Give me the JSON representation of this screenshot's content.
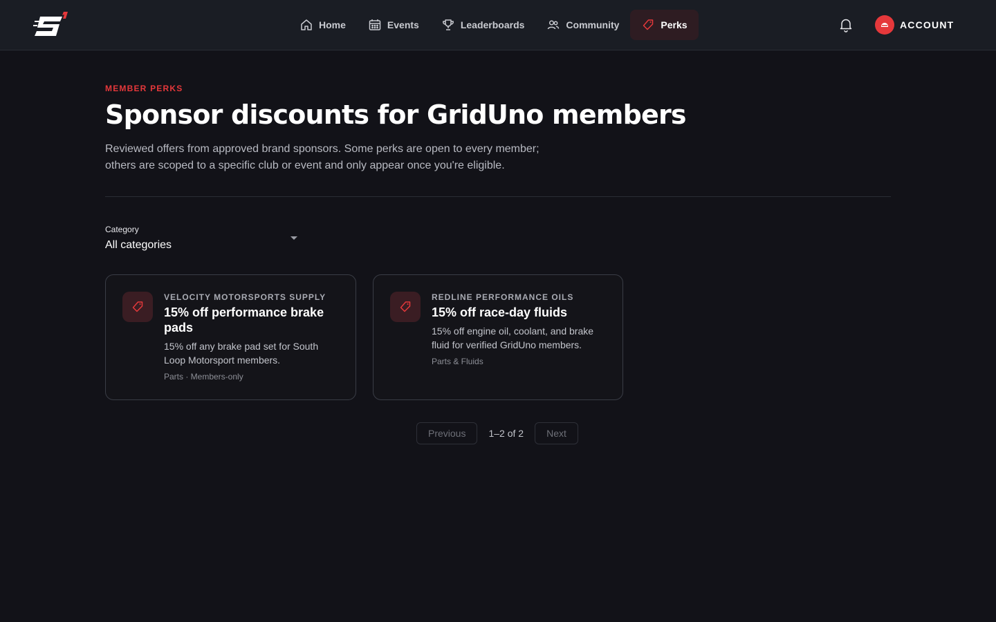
{
  "colors": {
    "accent": "#e5383b",
    "background": "#121218",
    "topbar": "#1a1d24",
    "active_nav_bg": "#2e1c22"
  },
  "header": {
    "logo_icon": "gridUno-logo",
    "nav": [
      {
        "label": "Home",
        "icon": "home-icon",
        "active": false
      },
      {
        "label": "Events",
        "icon": "calendar-icon",
        "active": false
      },
      {
        "label": "Leaderboards",
        "icon": "trophy-icon",
        "active": false
      },
      {
        "label": "Community",
        "icon": "users-icon",
        "active": false
      },
      {
        "label": "Perks",
        "icon": "tag-icon",
        "active": true
      }
    ],
    "notifications_icon": "bell-icon",
    "account_label": "ACCOUNT"
  },
  "main": {
    "eyebrow": "MEMBER PERKS",
    "title": "Sponsor discounts for GridUno members",
    "description_line1": "Reviewed offers from approved brand sponsors. Some perks are open to every member;",
    "description_line2": "others are scoped to a specific club or event and only appear once you're eligible.",
    "filter": {
      "label": "Category",
      "value": "All categories"
    },
    "perks": [
      {
        "sponsor": "VELOCITY MOTORSPORTS SUPPLY",
        "title": "15% off performance brake pads",
        "description": "15% off any brake pad set for South Loop Motorsport members.",
        "meta": "Parts · Members-only",
        "icon": "tag-icon"
      },
      {
        "sponsor": "REDLINE PERFORMANCE OILS",
        "title": "15% off race-day fluids",
        "description": "15% off engine oil, coolant, and brake fluid for verified GridUno members.",
        "meta": "Parts & Fluids",
        "icon": "tag-icon"
      }
    ],
    "pagination": {
      "previous": "Previous",
      "info": "1–2 of 2",
      "next": "Next"
    }
  }
}
